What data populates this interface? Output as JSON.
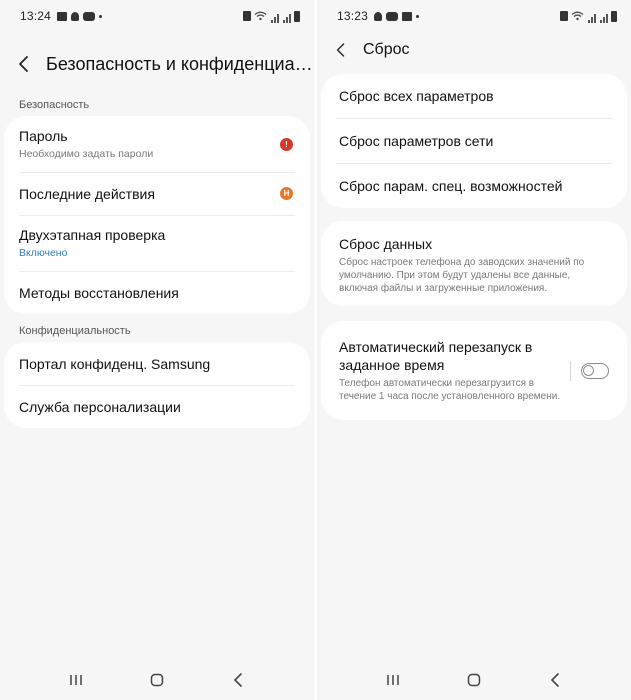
{
  "left": {
    "status": {
      "time": "13:24"
    },
    "header": {
      "title": "Безопасность и конфиденциал..."
    },
    "sections": {
      "security": "Безопасность",
      "privacy": "Конфиденциальность"
    },
    "security_items": [
      {
        "label": "Пароль",
        "sub": "Необходимо задать пароли",
        "badge": "!",
        "badge_color": "#d23a2a"
      },
      {
        "label": "Последние действия",
        "badge": "Н",
        "badge_color": "#e8772a"
      },
      {
        "label": "Двухэтапная проверка",
        "sub": "Включено"
      },
      {
        "label": "Методы восстановления"
      }
    ],
    "privacy_items": [
      {
        "label": "Портал конфиденц. Samsung"
      },
      {
        "label": "Служба персонализации"
      }
    ]
  },
  "right": {
    "status": {
      "time": "13:23"
    },
    "header": {
      "title": "Сброс"
    },
    "reset_items": [
      {
        "label": "Сброс всех параметров"
      },
      {
        "label": "Сброс параметров сети"
      },
      {
        "label": "Сброс парам. спец. возможностей"
      }
    ],
    "factory": {
      "label": "Сброс данных",
      "sub": "Сброс настроек телефона до заводских значений по умолчанию. При этом будут удалены все данные, включая файлы и загруженные приложения."
    },
    "auto_restart": {
      "label": "Автоматический перезапуск в заданное время",
      "sub": "Телефон автоматически перезагрузится в течение 1 часа после установленного времени.",
      "enabled": false
    }
  },
  "icons": {
    "back": "chevron-left-icon",
    "recents": "recents-icon",
    "home": "home-icon",
    "nav_back": "nav-back-icon"
  }
}
